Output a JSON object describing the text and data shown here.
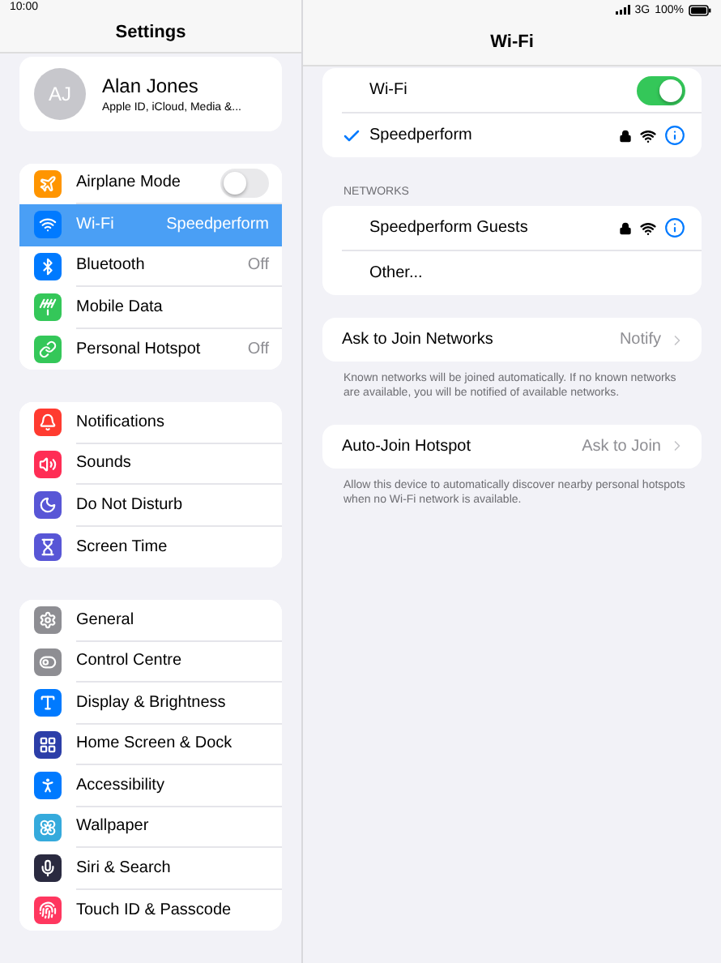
{
  "status_bar": {
    "time": "10:00",
    "network": "3G",
    "battery": "100%"
  },
  "sidebar": {
    "title": "Settings",
    "profile": {
      "initials": "AJ",
      "name": "Alan Jones",
      "subtitle": "Apple ID, iCloud, Media &..."
    },
    "groups": [
      [
        {
          "label": "Airplane Mode",
          "kind": "toggle",
          "on": false,
          "selected": false,
          "color": "#ff9500"
        },
        {
          "label": "Wi-Fi",
          "value": "Speedperform",
          "kind": "link",
          "selected": true,
          "color": "#007aff"
        },
        {
          "label": "Bluetooth",
          "value": "Off",
          "kind": "link",
          "selected": false,
          "color": "#007aff"
        },
        {
          "label": "Mobile Data",
          "kind": "link",
          "selected": false,
          "color": "#34c759"
        },
        {
          "label": "Personal Hotspot",
          "value": "Off",
          "kind": "link",
          "selected": false,
          "color": "#34c759"
        }
      ],
      [
        {
          "label": "Notifications",
          "kind": "link",
          "selected": false,
          "color": "#ff3b30"
        },
        {
          "label": "Sounds",
          "kind": "link",
          "selected": false,
          "color": "#ff2d55"
        },
        {
          "label": "Do Not Disturb",
          "kind": "link",
          "selected": false,
          "color": "#5856d6"
        },
        {
          "label": "Screen Time",
          "kind": "link",
          "selected": false,
          "color": "#5856d6"
        }
      ],
      [
        {
          "label": "General",
          "kind": "link",
          "selected": false,
          "color": "#8e8e93"
        },
        {
          "label": "Control Centre",
          "kind": "link",
          "selected": false,
          "color": "#8e8e93"
        },
        {
          "label": "Display & Brightness",
          "kind": "link",
          "selected": false,
          "color": "#007aff"
        },
        {
          "label": "Home Screen & Dock",
          "kind": "link",
          "selected": false,
          "color": "#2c3ea8"
        },
        {
          "label": "Accessibility",
          "kind": "link",
          "selected": false,
          "color": "#007aff"
        },
        {
          "label": "Wallpaper",
          "kind": "link",
          "selected": false,
          "color": "#35aadc"
        },
        {
          "label": "Siri & Search",
          "kind": "link",
          "selected": false,
          "color": "#2a2a40"
        },
        {
          "label": "Touch ID & Passcode",
          "kind": "link",
          "selected": false,
          "color": "#ff375f"
        }
      ]
    ]
  },
  "detail": {
    "title": "Wi-Fi",
    "wifi": {
      "label": "Wi-Fi",
      "on": true
    },
    "current": {
      "name": "Speedperform",
      "connected": true
    },
    "networks_header": "NETWORKS",
    "networks": [
      {
        "name": "Speedperform Guests"
      }
    ],
    "other": "Other...",
    "options": [
      {
        "label": "Ask to Join Networks",
        "value": "Notify",
        "note": "Known networks will be joined automatically. If no known networks are available, you will be notified of available networks."
      },
      {
        "label": "Auto-Join Hotspot",
        "value": "Ask to Join",
        "note": "Allow this device to automatically discover nearby personal hotspots when no Wi-Fi network is available."
      }
    ]
  }
}
